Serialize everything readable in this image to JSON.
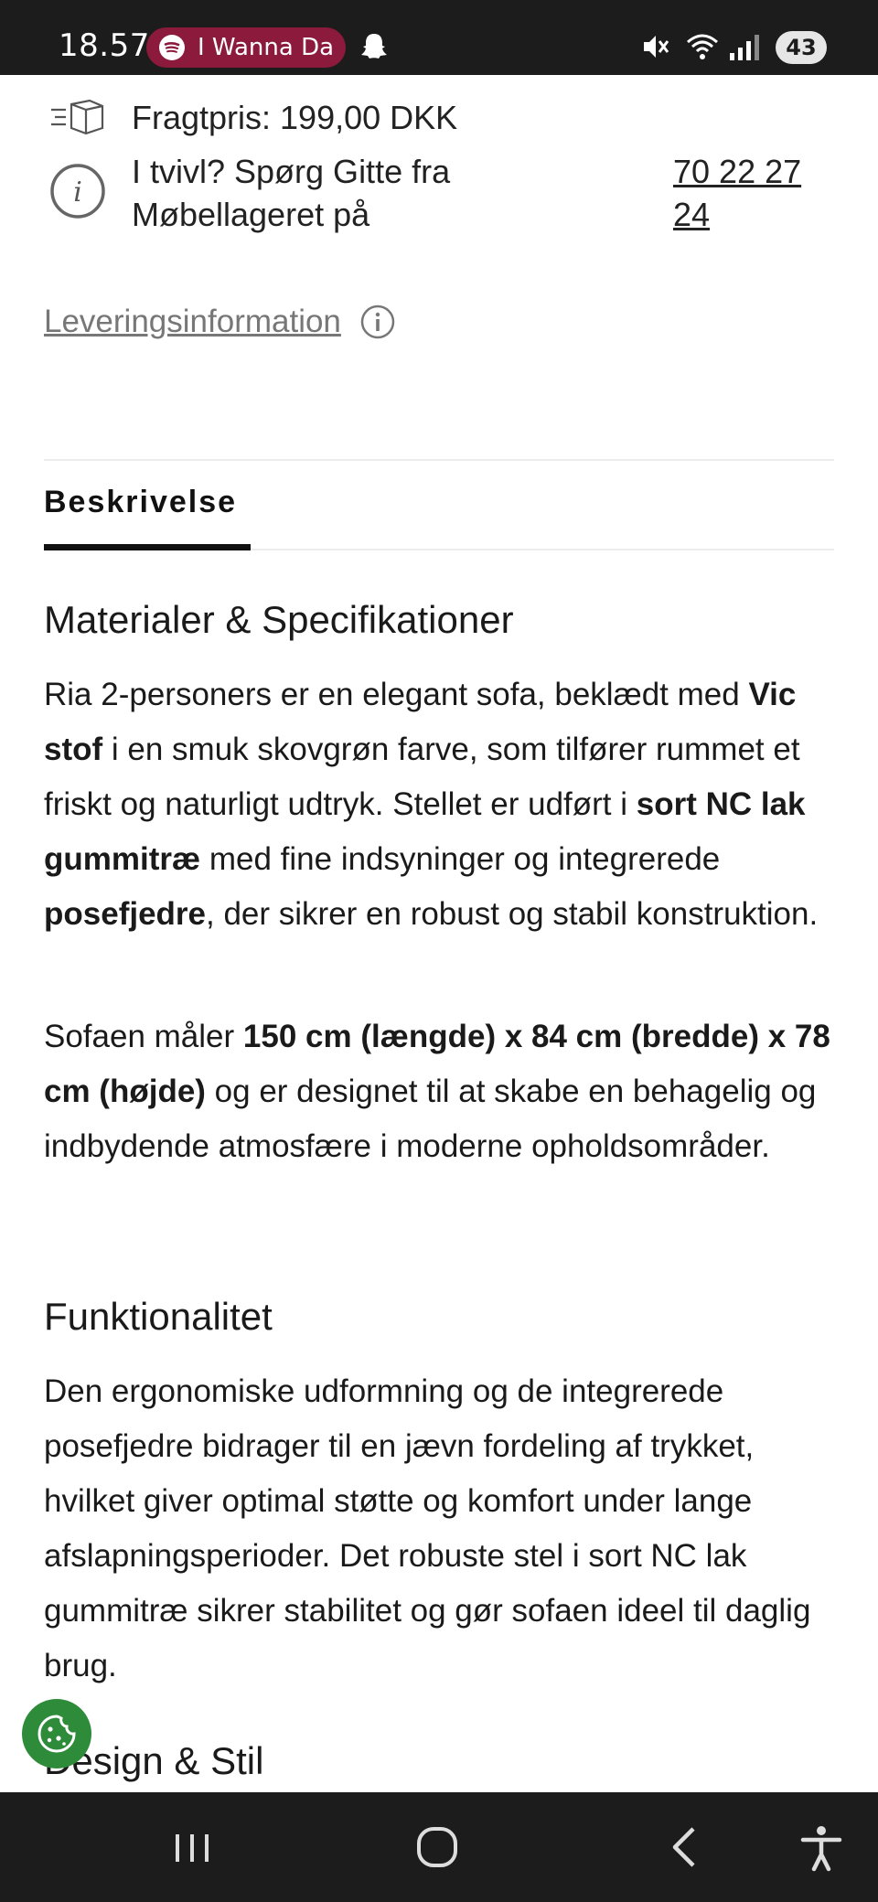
{
  "status_bar": {
    "time": "18.57",
    "media_pill_text": "I Wanna Da",
    "battery": "43",
    "icons": [
      "spotify-icon",
      "snapchat-ghost-icon",
      "mute-icon",
      "wifi-icon",
      "signal-icon",
      "battery-icon"
    ]
  },
  "shipping": {
    "freight_label": "Fragtpris: 199,00 DKK",
    "help_text": "I tvivl? Spørg Gitte fra Møbellageret på",
    "phone": "70 22 27 24"
  },
  "delivery_link": "Leveringsinformation",
  "tabs": {
    "description": "Beskrivelse"
  },
  "sections": {
    "materials": {
      "heading": "Materialer & Specifikationer",
      "p1": {
        "t1": "Ria 2-personers er en elegant sofa, beklædt med ",
        "b1": "Vic stof",
        "t2": " i en smuk skovgrøn farve, som tilfører rummet et friskt og naturligt udtryk. Stellet er udført i ",
        "b2": "sort NC lak gummitræ",
        "t3": " med fine indsyninger og integrerede ",
        "b3": "posefjedre",
        "t4": ", der sikrer en robust og stabil konstruktion."
      },
      "p2": {
        "t1": "Sofaen måler ",
        "b1": "150 cm (længde) x 84 cm (bredde) x 78 cm (højde)",
        "t2": " og er designet til at skabe en behagelig og indbydende atmosfære i moderne opholdsområder."
      }
    },
    "functionality": {
      "heading": "Funktionalitet",
      "p1": "Den ergonomiske udformning og de integrerede posefjedre bidrager til en jævn fordeling af trykket, hvilket giver optimal støtte og komfort under lange afslapningsperioder. Det robuste stel i sort NC lak gummitræ sikrer stabilitet og gør sofaen ideel til daglig brug."
    },
    "design": {
      "heading": "Design & Stil"
    }
  },
  "colors": {
    "accent_green": "#2e8b3a",
    "pill": "#8c1a3c",
    "bar": "#1c1c1c"
  }
}
